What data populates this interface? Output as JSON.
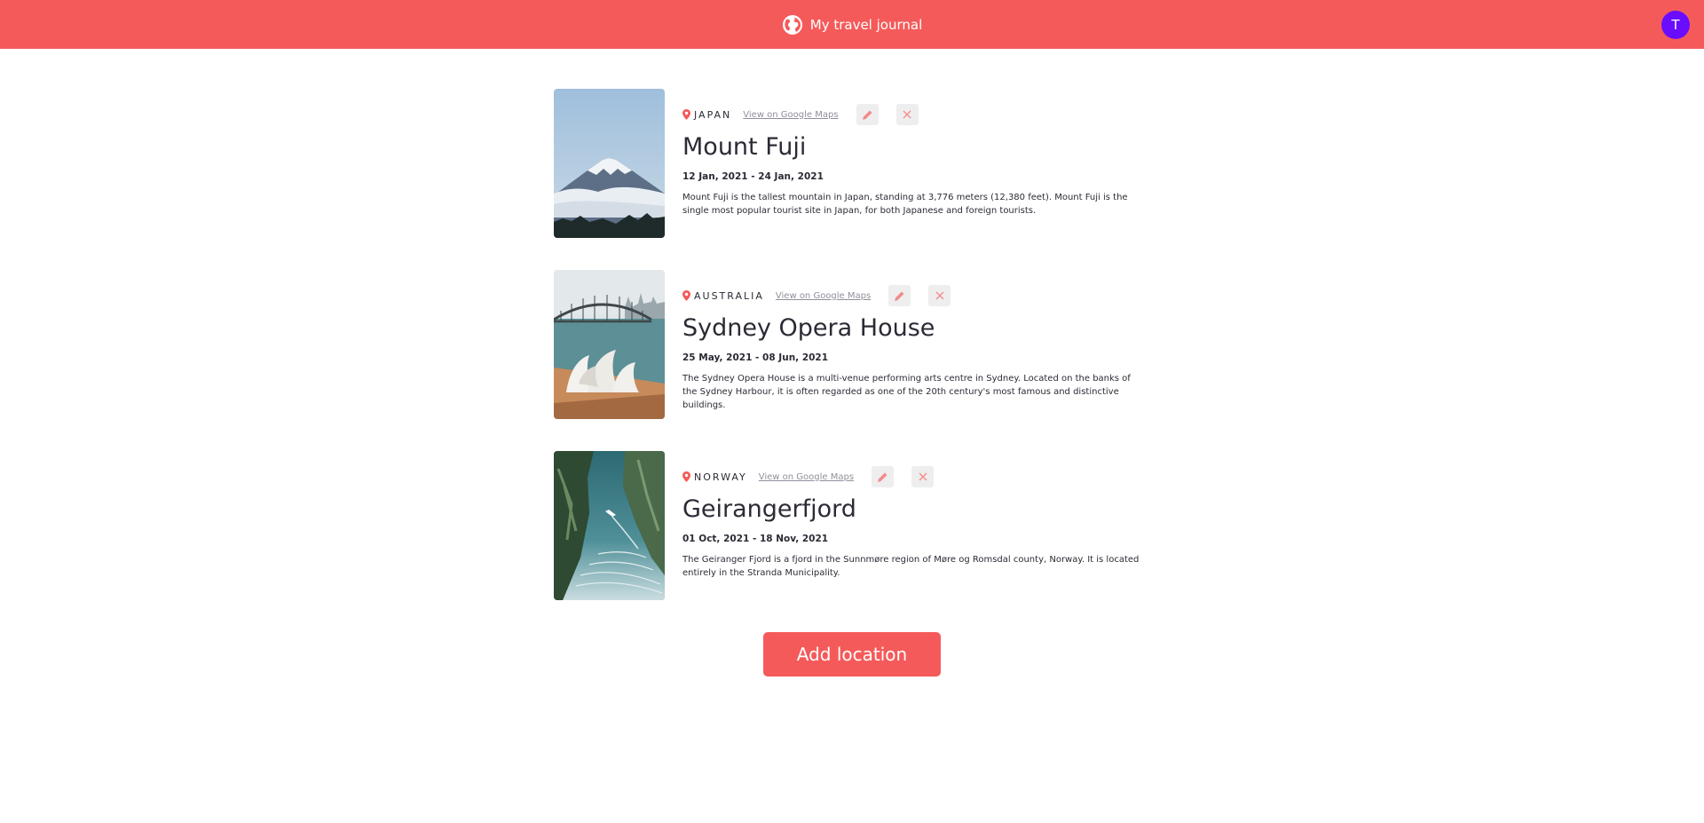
{
  "header": {
    "title": "My travel journal",
    "icon": "globe-icon",
    "avatar_letter": "T",
    "avatar_color": "#6a0dff",
    "brand_color": "#f55a5a"
  },
  "entries": [
    {
      "country": "JAPAN",
      "maps_label": "View on Google Maps",
      "title": "Mount Fuji",
      "dates": "12 Jan, 2021 - 24 Jan, 2021",
      "description": "Mount Fuji is the tallest mountain in Japan, standing at 3,776 meters (12,380 feet). Mount Fuji is the single most popular tourist site in Japan, for both Japanese and foreign tourists."
    },
    {
      "country": "AUSTRALIA",
      "maps_label": "View on Google Maps",
      "title": "Sydney Opera House",
      "dates": "25 May, 2021 - 08 Jun, 2021",
      "description": "The Sydney Opera House is a multi-venue performing arts centre in Sydney. Located on the banks of the Sydney Harbour, it is often regarded as one of the 20th century's most famous and distinctive buildings."
    },
    {
      "country": "NORWAY",
      "maps_label": "View on Google Maps",
      "title": "Geirangerfjord",
      "dates": "01 Oct, 2021 - 18 Nov, 2021",
      "description": "The Geiranger Fjord is a fjord in the Sunnmøre region of Møre og Romsdal county, Norway. It is located entirely in the Stranda Municipality."
    }
  ],
  "add_button_label": "Add location"
}
